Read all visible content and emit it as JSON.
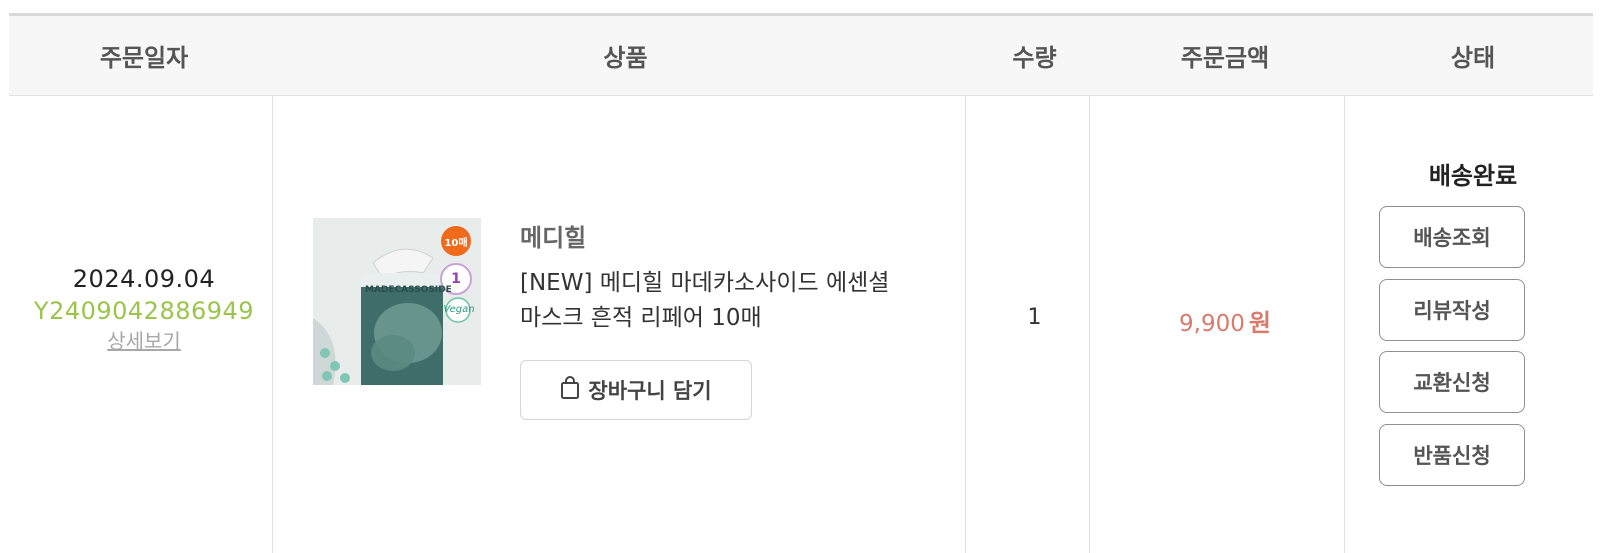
{
  "header": {
    "col_date": "주문일자",
    "col_product": "상품",
    "col_qty": "수량",
    "col_amount": "주문금액",
    "col_status": "상태"
  },
  "order": {
    "date": "2024.09.04",
    "number": "Y2409042886949",
    "detail_link": "상세보기",
    "product": {
      "brand": "메디힐",
      "name_line1": "[NEW] 메디힐 마데카소사이드 에센셜",
      "name_line2": "마스크 흔적 리페어 10매",
      "image_label": "MADECASSOSIDE",
      "badge_count": "10매",
      "badge_rank": "1",
      "badge_vegan": "Vegan",
      "cart_button": "장바구니 담기"
    },
    "quantity": "1",
    "amount": "9,900",
    "amount_unit": "원",
    "status": "배송완료",
    "actions": {
      "track": "배송조회",
      "review": "리뷰작성",
      "exchange": "교환신청",
      "return": "반품신청"
    }
  },
  "colors": {
    "order_number": "#9bc54a",
    "amount": "#d97b6c",
    "header_bg": "#f7f7f7"
  }
}
